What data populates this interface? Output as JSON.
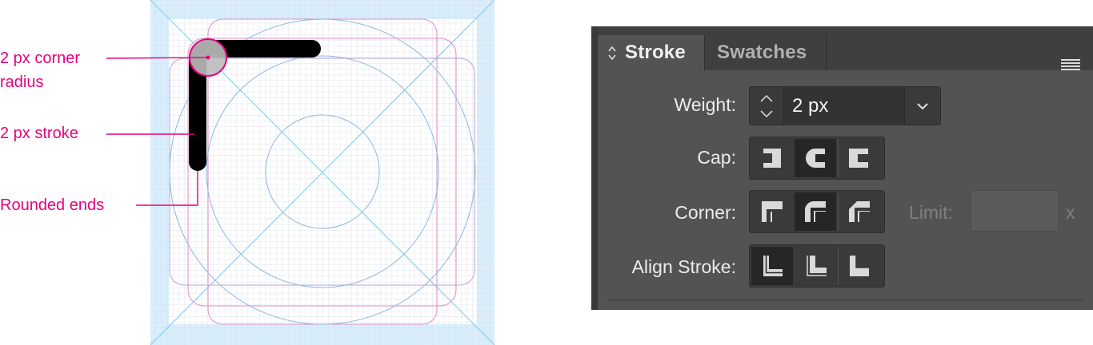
{
  "annotations": {
    "corner_radius_line1": "2 px corner",
    "corner_radius_line2": "radius",
    "stroke": "2 px stroke",
    "rounded_ends": "Rounded ends"
  },
  "colors": {
    "annotation": "#e6007e",
    "keyline_blue": "#7fb0e0",
    "keyline_pink": "#e08cc8",
    "safe_area": "#d8eefc",
    "panel_bg": "#535353",
    "panel_well": "#3a3a3a",
    "button_selected": "#262626"
  },
  "panel": {
    "tabs": [
      {
        "label": "Stroke",
        "active": true
      },
      {
        "label": "Swatches",
        "active": false
      }
    ],
    "weight": {
      "label": "Weight:",
      "value": "2 px"
    },
    "cap": {
      "label": "Cap:",
      "options": [
        {
          "icon": "butt-cap-icon",
          "selected": false
        },
        {
          "icon": "round-cap-icon",
          "selected": true
        },
        {
          "icon": "projecting-cap-icon",
          "selected": false
        }
      ]
    },
    "corner": {
      "label": "Corner:",
      "options": [
        {
          "icon": "miter-join-icon",
          "selected": false
        },
        {
          "icon": "round-join-icon",
          "selected": true
        },
        {
          "icon": "bevel-join-icon",
          "selected": false
        }
      ],
      "limit_label": "Limit:",
      "limit_value": "",
      "limit_unit": "x"
    },
    "align_stroke": {
      "label": "Align Stroke:",
      "options": [
        {
          "icon": "align-center-icon",
          "selected": true
        },
        {
          "icon": "align-inside-icon",
          "selected": false
        },
        {
          "icon": "align-outside-icon",
          "selected": false
        }
      ]
    }
  }
}
